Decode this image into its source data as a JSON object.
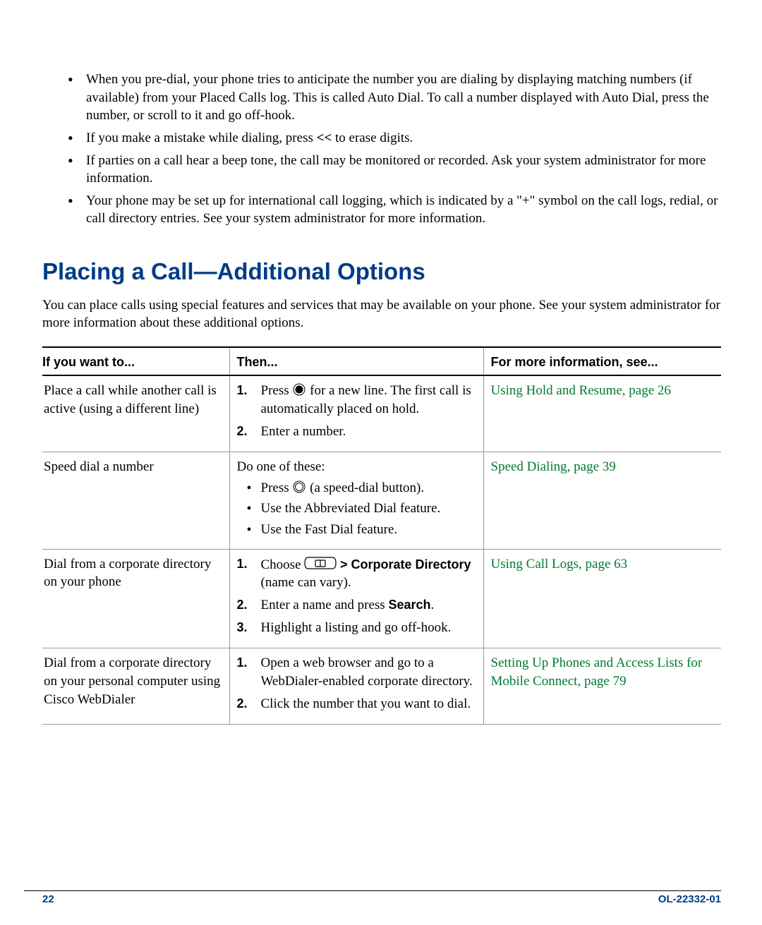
{
  "bullets": {
    "b1": "When you pre-dial, your phone tries to anticipate the number you are dialing by displaying matching numbers (if available) from your Placed Calls log. This is called Auto Dial. To call a number displayed with Auto Dial, press the number, or scroll to it and go off-hook.",
    "b2_pre": "If you make a mistake while dialing, press ",
    "b2_sym": "<<",
    "b2_post": " to erase digits.",
    "b3": "If parties on a call hear a beep tone, the call may be monitored or recorded. Ask your system administrator for more information.",
    "b4": "Your phone may be set up for international call logging, which is indicated by a \"+\" symbol on the call logs, redial, or call directory entries. See your system administrator for more information."
  },
  "heading": "Placing a Call—Additional Options",
  "intro": "You can place calls using special features and services that may be available on your phone. See your system administrator for more information about these additional options.",
  "columns": {
    "c1": "If you want to...",
    "c2": "Then...",
    "c3": "For more information, see..."
  },
  "rows": {
    "r1": {
      "want": "Place a call while another call is active (using a different line)",
      "s1_pre": "Press ",
      "s1_post": " for a new line. The first call is automatically placed on hold.",
      "s2": "Enter a number.",
      "link": "Using Hold and Resume, page 26"
    },
    "r2": {
      "want": "Speed dial a number",
      "lead": "Do one of these:",
      "i1_pre": "Press ",
      "i1_post": " (a speed-dial button).",
      "i2": "Use the Abbreviated Dial feature.",
      "i3": "Use the Fast Dial feature.",
      "link": "Speed Dialing, page 39"
    },
    "r3": {
      "want": "Dial from a corporate directory on your phone",
      "s1_pre": "Choose ",
      "s1_mid": " > ",
      "s1_bold": "Corporate Directory",
      "s1_post": " (name can vary).",
      "s2_pre": "Enter a name and press ",
      "s2_bold": "Search",
      "s2_post": ".",
      "s3": "Highlight a listing and go off-hook.",
      "link": "Using Call Logs, page 63"
    },
    "r4": {
      "want": "Dial from a corporate directory on your personal computer using Cisco WebDialer",
      "s1": "Open a web browser and go to a WebDialer-enabled corporate directory.",
      "s2": "Click the number that you want to dial.",
      "link": "Setting Up Phones and Access Lists for Mobile Connect, page 79"
    }
  },
  "nums": {
    "n1": "1.",
    "n2": "2.",
    "n3": "3."
  },
  "footer": {
    "page": "22",
    "doc": "OL-22332-01"
  }
}
